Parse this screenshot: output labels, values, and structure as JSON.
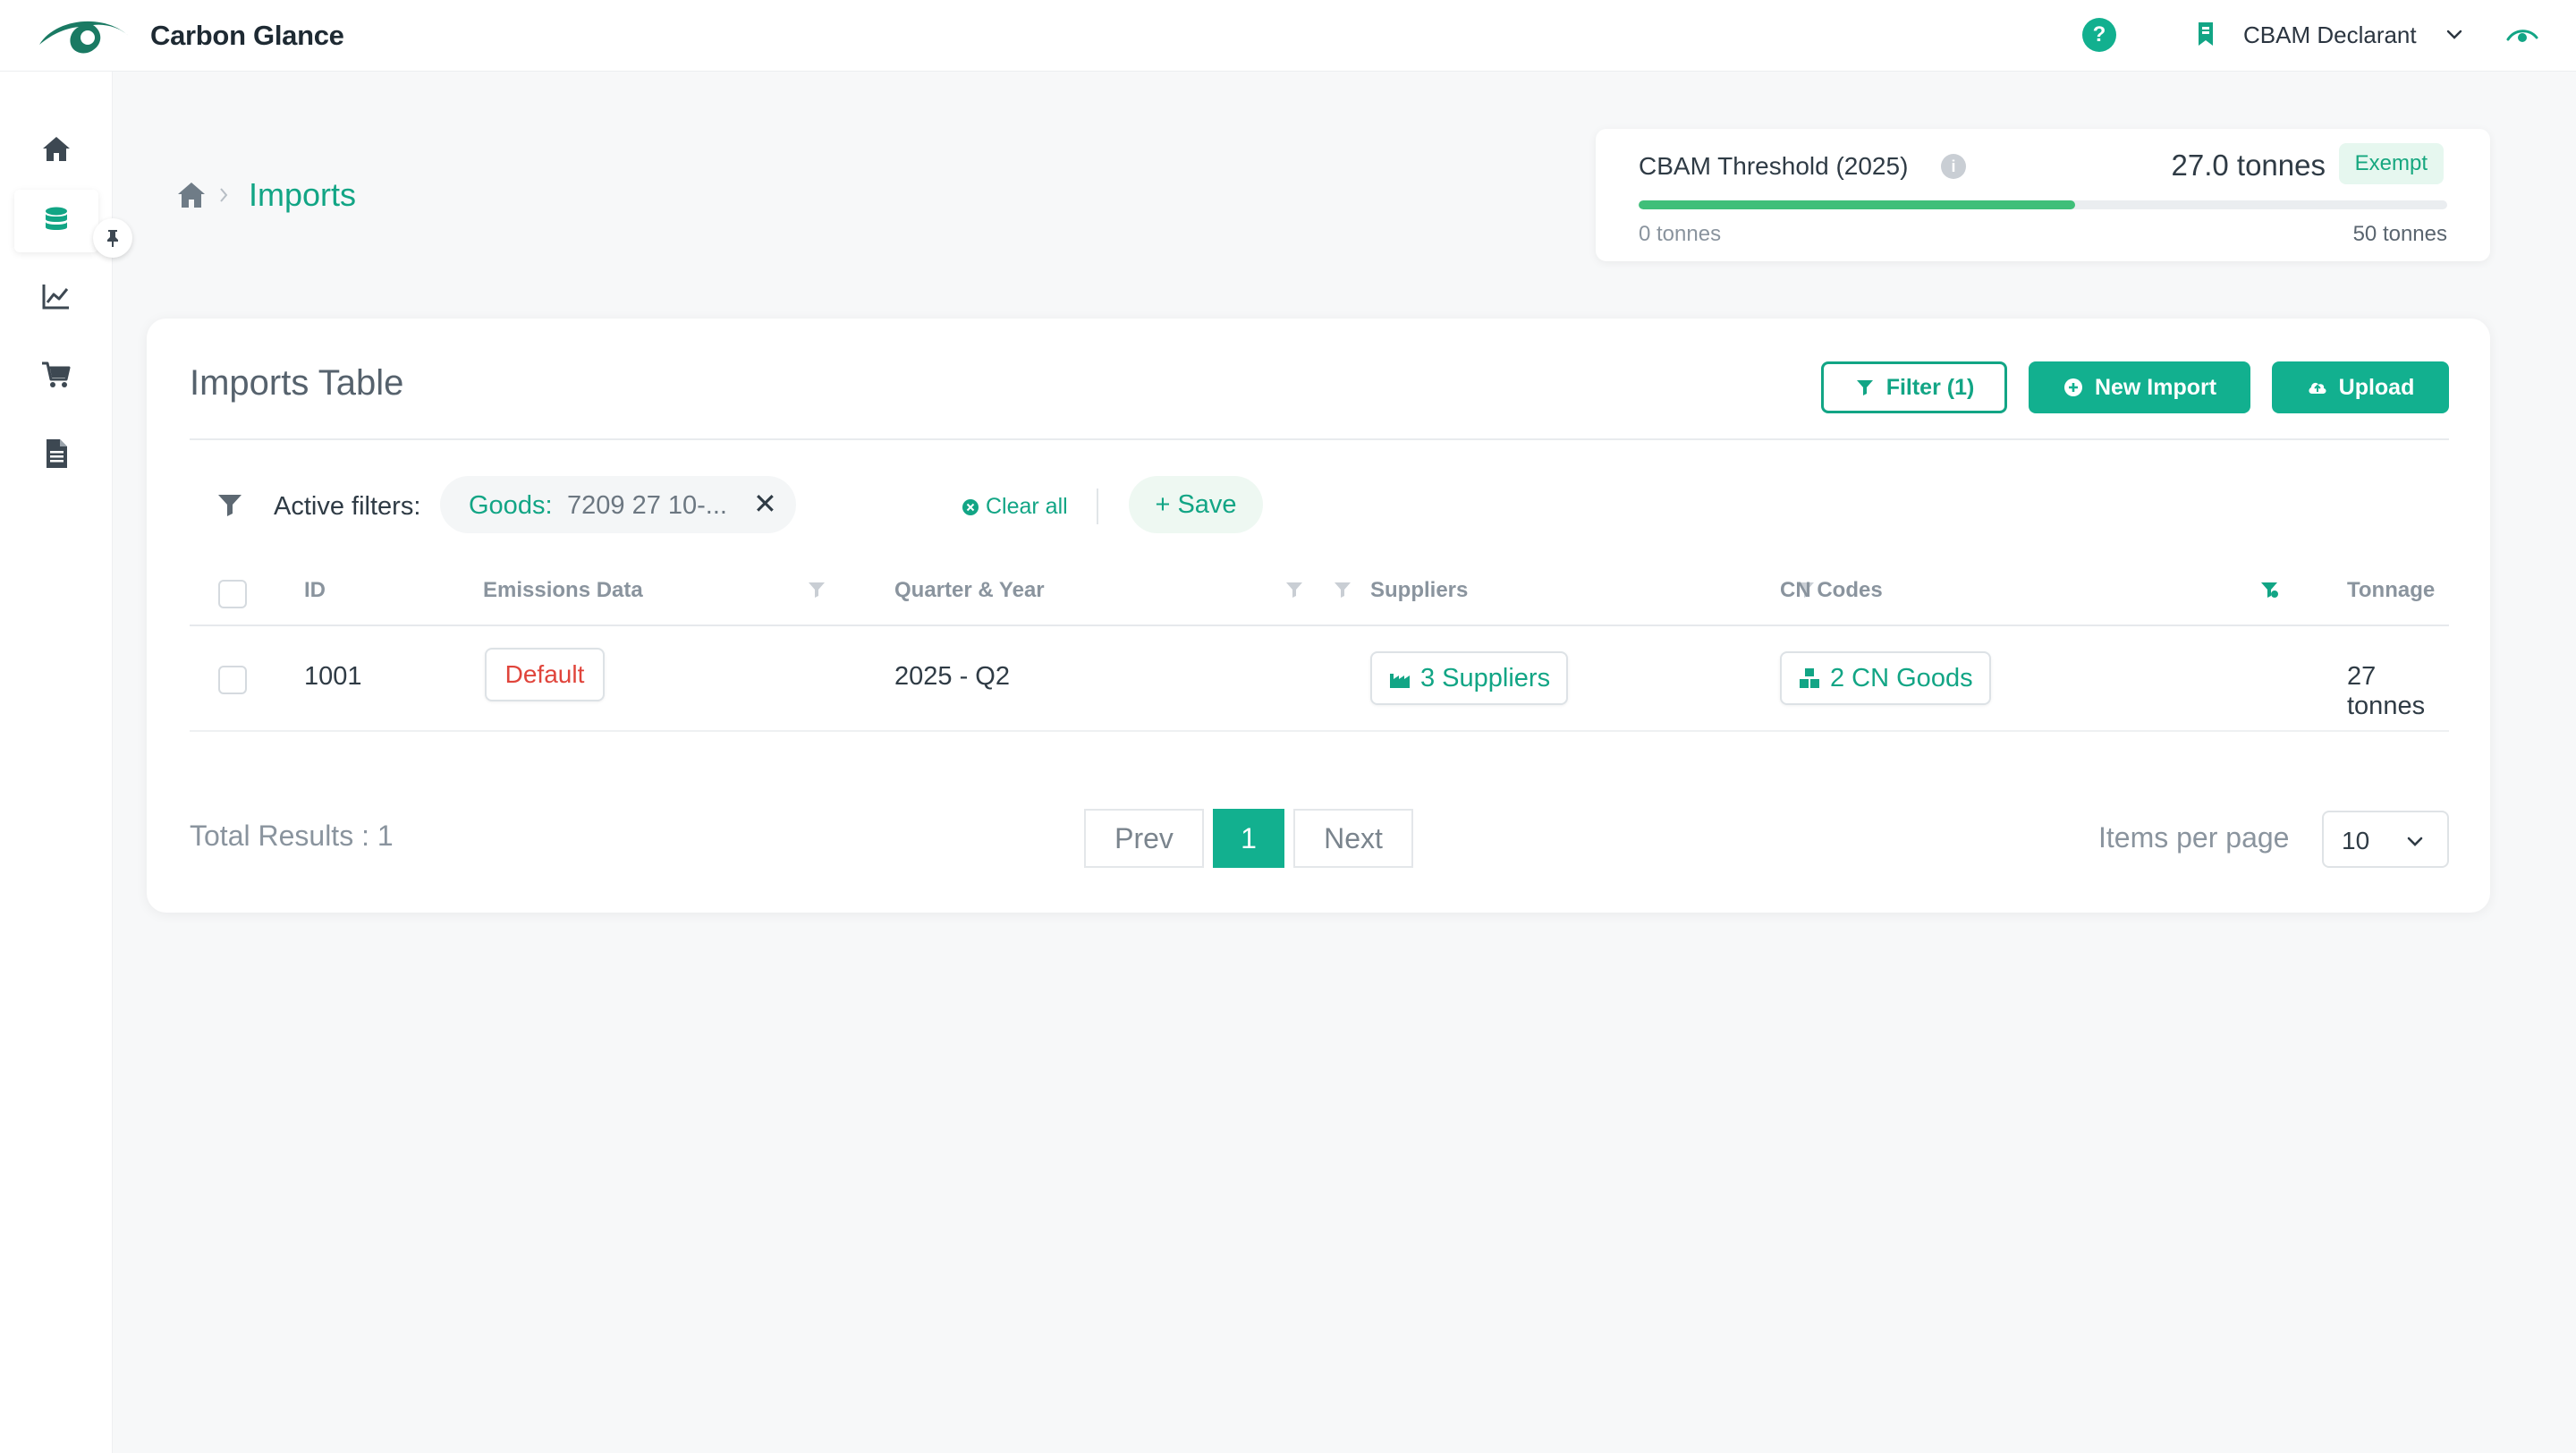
{
  "app": {
    "brand": "Carbon Glance",
    "help_icon": "question-circle-icon",
    "help_glyph": "?",
    "role": "CBAM Declarant",
    "accent": "#12b08f"
  },
  "sidebar": {
    "items": [
      {
        "name": "home",
        "icon": "home-icon"
      },
      {
        "name": "imports",
        "icon": "database-icon",
        "active": true
      },
      {
        "name": "analytics",
        "icon": "line-chart-icon"
      },
      {
        "name": "marketplace",
        "icon": "cart-icon"
      },
      {
        "name": "reports",
        "icon": "document-icon"
      }
    ],
    "pin_icon": "pin-icon"
  },
  "breadcrumb": {
    "current": "Imports"
  },
  "threshold": {
    "title": "CBAM Threshold (2025)",
    "value_label": "27.0 tonnes",
    "badge": "Exempt",
    "progress_fraction": 0.54,
    "min_label": "0 tonnes",
    "max_label": "50 tonnes",
    "info_glyph": "i"
  },
  "imports_table": {
    "title": "Imports Table",
    "buttons": {
      "filter": "Filter (1)",
      "new_import": "New Import",
      "upload": "Upload"
    },
    "filters": {
      "label": "Active filters:",
      "chip_key": "Goods:",
      "chip_value": "7209 27 10-...",
      "chip_remove": "✕",
      "clear_all": "Clear all",
      "save": "+ Save"
    },
    "columns": [
      "ID",
      "Emissions Data",
      "Quarter & Year",
      "Suppliers",
      "CN Codes",
      "Tonnage"
    ],
    "rows": [
      {
        "id": "1001",
        "emissions": "Default",
        "quarter": "2025 - Q2",
        "suppliers": "3 Suppliers",
        "cn_codes": "2 CN Goods",
        "tonnage": "27 tonnes"
      }
    ],
    "pagination": {
      "total": "Total Results : 1",
      "prev": "Prev",
      "current": "1",
      "next": "Next",
      "items_per_page_label": "Items per page",
      "items_per_page": "10"
    }
  }
}
